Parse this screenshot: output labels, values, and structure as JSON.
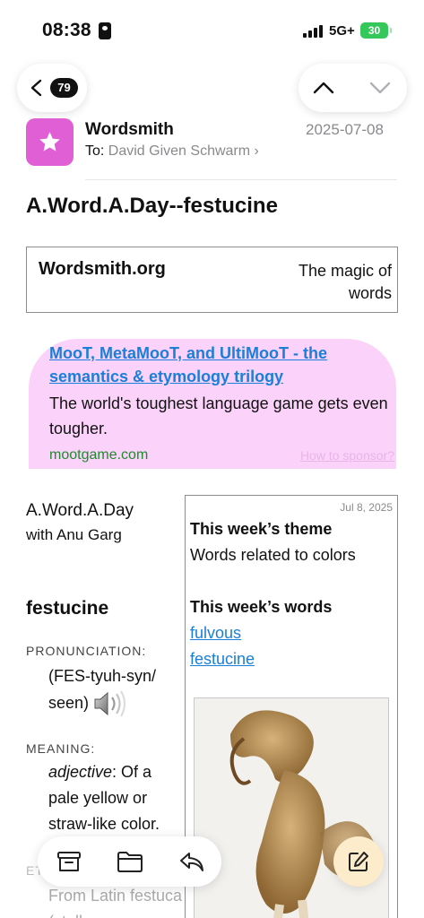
{
  "status_bar": {
    "time": "08:38",
    "network": "5G+",
    "battery": "30"
  },
  "nav": {
    "unread_count": "79"
  },
  "header": {
    "sender": "Wordsmith",
    "to_prefix": "To:",
    "to_name": "David Given Schwarm",
    "to_chevron": "›",
    "date": "2025-07-08",
    "avatar_color": "#e15fd5"
  },
  "subject": "A.Word.A.Day--festucine",
  "banner": {
    "brand": "Wordsmith.org",
    "tagline": "The magic of words"
  },
  "sponsor": {
    "link": "MooT, MetaMooT, and UltiMooT - the semantics & etymology trilogy",
    "description": "The world's toughest language game gets even tougher.",
    "url": "mootgame.com",
    "how_to": "How to sponsor?",
    "background": "#fbd3fa"
  },
  "awad": {
    "title": "A.Word.A.Day",
    "subtitle": "with Anu Garg"
  },
  "entry": {
    "word": "festucine",
    "pronunciation_label": "PRONUNCIATION:",
    "pronunciation": "(FES-tyuh-syn/ seen)",
    "meaning_label": "MEANING:",
    "part_of_speech": "adjective",
    "meaning": ": Of a pale yellow or straw-like color.",
    "etymology_label": "ETYMOLOGY:",
    "etymology": "From Latin festuca (stalk"
  },
  "week": {
    "date": "Jul 8, 2025",
    "theme_heading": "This week’s theme",
    "theme": "Words related to colors",
    "words_heading": "This week’s words",
    "words": [
      "fulvous",
      "festucine"
    ]
  },
  "accent_link_color": "#1a7fd9"
}
